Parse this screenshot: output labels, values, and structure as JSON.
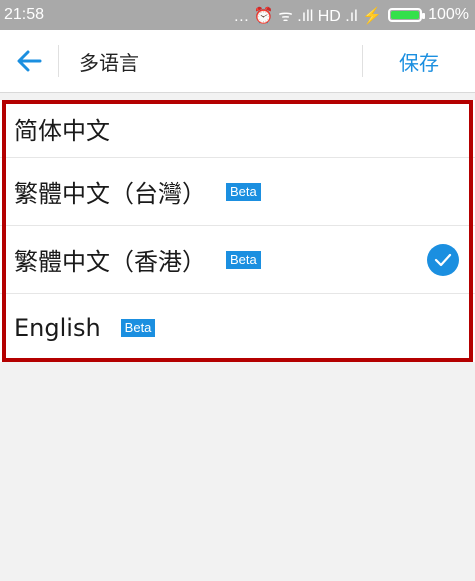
{
  "status_bar": {
    "time": "21:58",
    "indicators": "… ⏰ ᯤ .ıll HD .ıl ⚡",
    "battery": "100%",
    "battery_level": 1.0
  },
  "app_bar": {
    "back_icon": "arrow-left-icon",
    "title": "多语言",
    "save_label": "保存"
  },
  "languages": [
    {
      "label": "简体中文",
      "badge": "",
      "selected": false
    },
    {
      "label": "繁體中文（台灣）",
      "badge": "Beta",
      "selected": false
    },
    {
      "label": "繁體中文（香港）",
      "badge": "Beta",
      "selected": true
    },
    {
      "label": "English",
      "badge": "Beta",
      "selected": false
    }
  ],
  "colors": {
    "accent": "#1b8fe0",
    "highlight": "#b40000"
  }
}
